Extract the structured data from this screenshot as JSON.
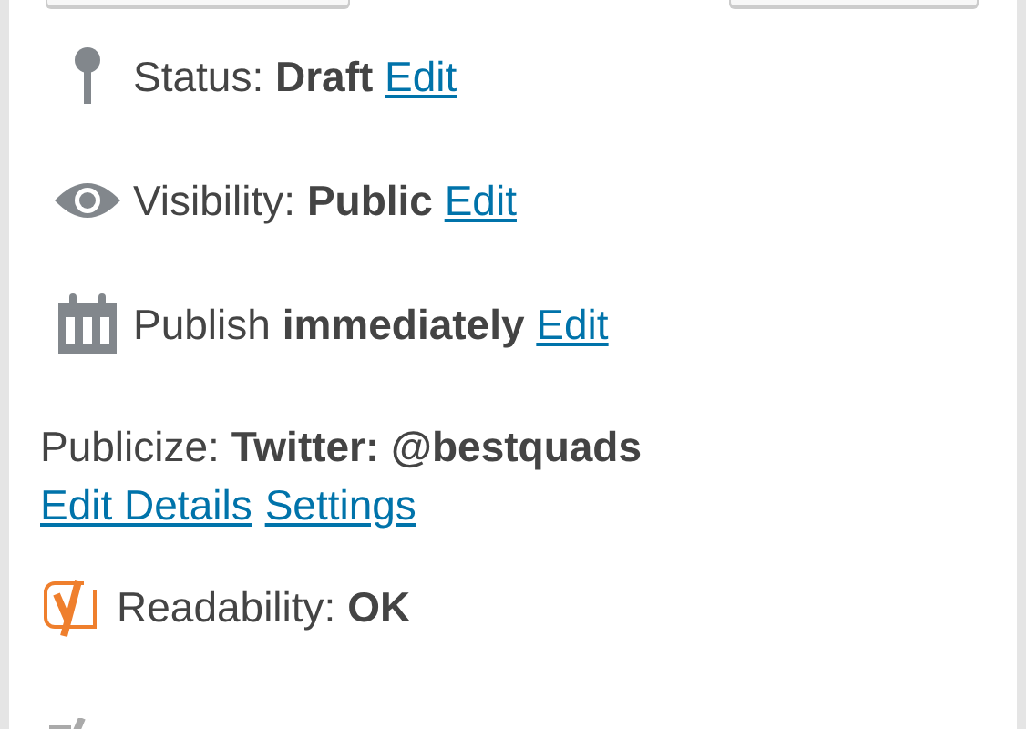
{
  "rows": [
    {
      "kind": "status",
      "label": "Status: ",
      "value": "Draft",
      "link": "Edit"
    },
    {
      "kind": "visibility",
      "label": "Visibility: ",
      "value": "Public",
      "link": "Edit"
    },
    {
      "kind": "publish",
      "label": "Publish ",
      "value": "immediately",
      "link": "Edit"
    }
  ],
  "publicize": {
    "label": "Publicize: ",
    "value": "Twitter: @bestquads",
    "links": [
      "Edit Details",
      "Settings"
    ]
  },
  "readability": {
    "label": "Readability: ",
    "value": "OK"
  }
}
